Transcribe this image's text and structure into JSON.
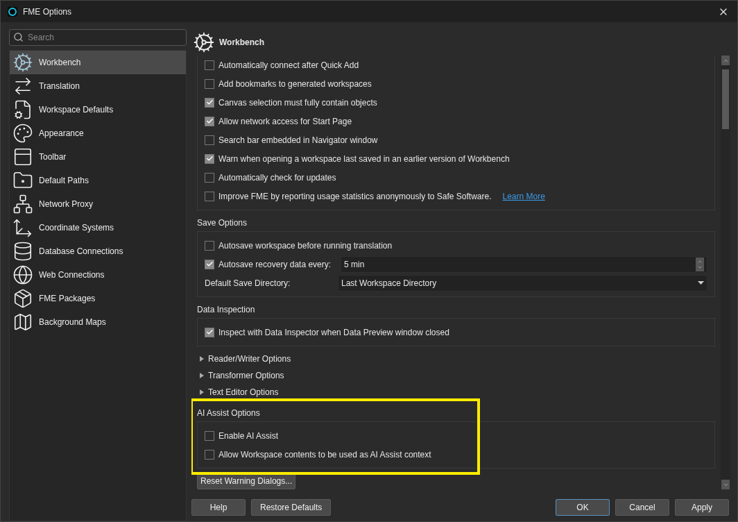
{
  "window": {
    "title": "FME Options"
  },
  "sidebar": {
    "search": {
      "placeholder": "Search"
    },
    "items": [
      {
        "label": "Workbench",
        "selected": true
      },
      {
        "label": "Translation",
        "selected": false
      },
      {
        "label": "Workspace Defaults",
        "selected": false
      },
      {
        "label": "Appearance",
        "selected": false
      },
      {
        "label": "Toolbar",
        "selected": false
      },
      {
        "label": "Default Paths",
        "selected": false
      },
      {
        "label": "Network Proxy",
        "selected": false
      },
      {
        "label": "Coordinate Systems",
        "selected": false
      },
      {
        "label": "Database Connections",
        "selected": false
      },
      {
        "label": "Web Connections",
        "selected": false
      },
      {
        "label": "FME Packages",
        "selected": false
      },
      {
        "label": "Background Maps",
        "selected": false
      }
    ]
  },
  "page": {
    "title": "Workbench",
    "general_options": [
      {
        "label": "Automatically connect after Quick Add",
        "checked": false
      },
      {
        "label": "Add bookmarks to generated workspaces",
        "checked": false
      },
      {
        "label": "Canvas selection must fully contain objects",
        "checked": true
      },
      {
        "label": "Allow network access for Start Page",
        "checked": true
      },
      {
        "label": "Search bar embedded in Navigator window",
        "checked": false
      },
      {
        "label": "Warn when opening a workspace last saved in an earlier version of Workbench",
        "checked": true
      },
      {
        "label": "Automatically check for updates",
        "checked": false
      },
      {
        "label": "Improve FME by reporting usage statistics anonymously to Safe Software.",
        "checked": false,
        "link": "Learn More"
      }
    ],
    "sections": [
      {
        "title": "Save Options",
        "highlighted": false,
        "rows": [
          {
            "kind": "checkbox",
            "label": "Autosave workspace before running translation",
            "checked": false
          },
          {
            "kind": "spin",
            "label": "Autosave recovery data every:",
            "checked": true,
            "value": "5 min"
          },
          {
            "kind": "dropdown",
            "label": "Default Save Directory:",
            "value": "Last Workspace Directory"
          }
        ]
      },
      {
        "title": "Data Inspection",
        "highlighted": false,
        "rows": [
          {
            "kind": "checkbox",
            "label": "Inspect with Data Inspector when Data Preview window closed",
            "checked": true
          }
        ]
      },
      {
        "kind": "expander",
        "title": "Reader/Writer Options",
        "expanded": false
      },
      {
        "kind": "expander",
        "title": "Transformer Options",
        "expanded": false
      },
      {
        "kind": "expander",
        "title": "Text Editor Options",
        "expanded": false
      },
      {
        "title": "AI Assist Options",
        "highlighted": true,
        "rows": [
          {
            "kind": "checkbox",
            "label": "Enable AI Assist",
            "checked": false
          },
          {
            "kind": "checkbox",
            "label": "Allow Workspace contents to be used as AI Assist context",
            "checked": false
          }
        ]
      }
    ],
    "reset_button": "Reset Warning Dialogs..."
  },
  "footer": {
    "left_buttons": [
      "Help",
      "Restore Defaults"
    ],
    "right_buttons": [
      {
        "label": "OK",
        "default": true
      },
      {
        "label": "Cancel",
        "default": false
      },
      {
        "label": "Apply",
        "default": false
      }
    ]
  }
}
